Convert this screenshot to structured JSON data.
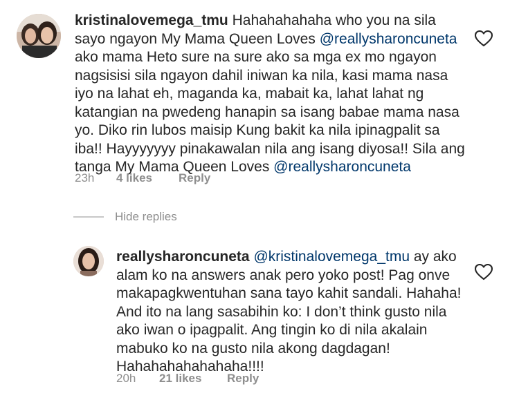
{
  "comment1": {
    "username": "kristinalovemega_tmu",
    "text_a": " Hahahahahaha who you na sila sayo ngayon My Mama Queen Loves ",
    "mention_a": "@reallysharoncuneta",
    "text_b": " ako mama Heto sure na sure ako sa mga ex mo ngayon nagsisisi sila ngayon dahil iniwan ka nila, kasi mama nasa iyo na lahat eh, maganda ka, mabait ka, lahat lahat ng katangian na pwedeng hanapin sa isang babae mama nasa yo. Diko rin lubos maisip Kung bakit ka nila ipinagpalit sa iba!! Hayyyyyyy pinakawalan nila ang isang diyosa!! Sila ang tanga My Mama Queen Loves ",
    "mention_b": "@reallysharoncuneta",
    "time": "23h",
    "likes": "4 likes",
    "reply_label": "Reply"
  },
  "hide_replies_label": "Hide replies",
  "comment2": {
    "username": "reallysharoncuneta",
    "mention": "@kristinalovemega_tmu",
    "text": " ay ako alam ko na answers anak pero yoko post! Pag onve makapagkwentuhan sana tayo kahit sandali. Hahaha! And ito na lang sasabihin ko: I don’t think gusto nila ako iwan o ipagpalit. Ang tingin ko di nila akalain mabuko ko na gusto nila akong dagdagan! Hahahahahahahaha!!!!",
    "time": "20h",
    "likes": "21 likes",
    "reply_label": "Reply"
  },
  "colors": {
    "text": "#262626",
    "mention": "#00376b",
    "meta": "#8e8e8e"
  }
}
